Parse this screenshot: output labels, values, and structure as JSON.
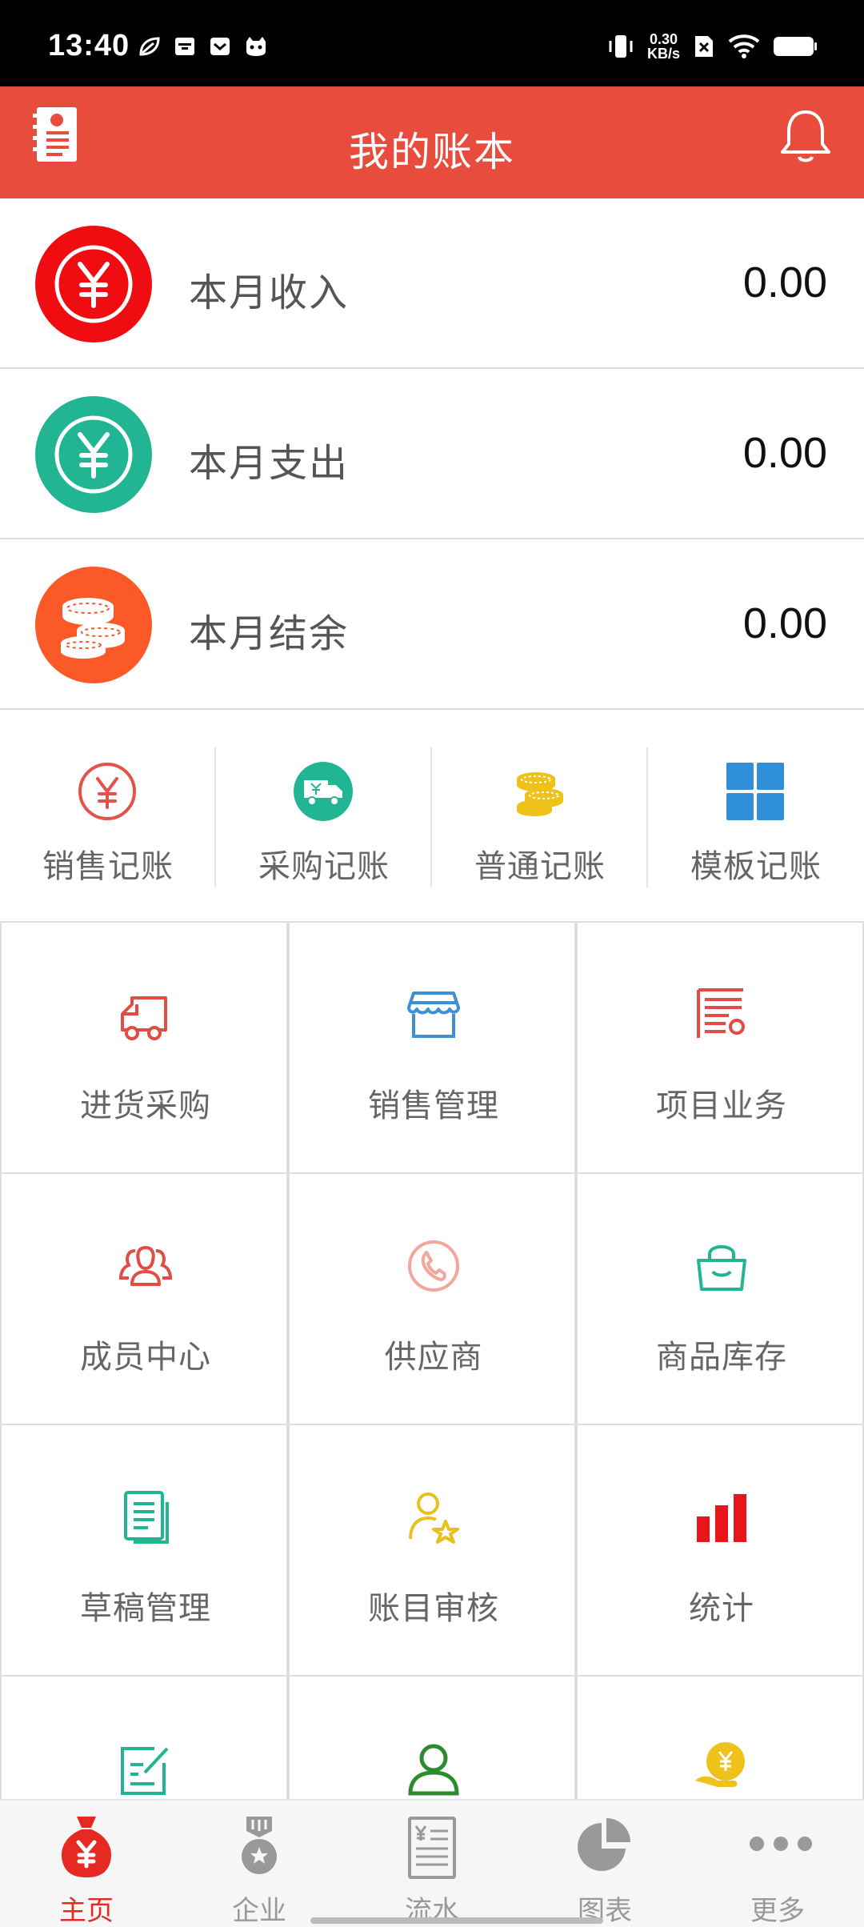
{
  "status_bar": {
    "time": "13:40",
    "net_speed_value": "0.30",
    "net_speed_unit": "KB/s",
    "icons": [
      "leaf-icon",
      "archive-icon",
      "message-icon",
      "cat-icon",
      "vibrate-icon",
      "sim-x-icon",
      "wifi-icon",
      "battery-icon"
    ]
  },
  "header": {
    "title": "我的账本",
    "left_icon": "ledger-book-icon",
    "right_icon": "bell-icon",
    "background": "#e84c3d"
  },
  "summary": [
    {
      "label": "本月收入",
      "value": "0.00",
      "icon": "yuan-circle-icon",
      "color": "#f00d12"
    },
    {
      "label": "本月支出",
      "value": "0.00",
      "icon": "yuan-circle-icon",
      "color": "#21b594"
    },
    {
      "label": "本月结余",
      "value": "0.00",
      "icon": "coins-icon",
      "color": "#fb5a28"
    }
  ],
  "quick_actions": [
    {
      "label": "销售记账",
      "icon": "yuan-outline-icon",
      "color": "#e4524a"
    },
    {
      "label": "采购记账",
      "icon": "truck-icon",
      "color": "#21b594"
    },
    {
      "label": "普通记账",
      "icon": "coins-stack-icon",
      "color": "#efc21a"
    },
    {
      "label": "模板记账",
      "icon": "grid-squares-icon",
      "color": "#2f8fd8"
    }
  ],
  "grid": [
    {
      "label": "进货采购",
      "icon": "delivery-truck-icon",
      "color": "#e14c44"
    },
    {
      "label": "销售管理",
      "icon": "storefront-icon",
      "color": "#3d8fd6"
    },
    {
      "label": "项目业务",
      "icon": "document-list-icon",
      "color": "#e14c44"
    },
    {
      "label": "成员中心",
      "icon": "members-icon",
      "color": "#e14c44"
    },
    {
      "label": "供应商",
      "icon": "phone-icon",
      "color": "#f2a79c"
    },
    {
      "label": "商品库存",
      "icon": "shopping-bag-icon",
      "color": "#21b594"
    },
    {
      "label": "草稿管理",
      "icon": "draft-docs-icon",
      "color": "#21b594"
    },
    {
      "label": "账目审核",
      "icon": "user-star-icon",
      "color": "#e8c21c"
    },
    {
      "label": "统计",
      "icon": "bar-chart-icon",
      "color": "#e9151b"
    },
    {
      "label": "",
      "icon": "edit-note-icon",
      "color": "#21b594"
    },
    {
      "label": "",
      "icon": "person-icon",
      "color": "#2c8b2c"
    },
    {
      "label": "",
      "icon": "hand-yuan-icon",
      "color": "#efc21a"
    }
  ],
  "bottom_nav": [
    {
      "label": "主页",
      "icon": "money-bag-icon",
      "active": true
    },
    {
      "label": "企业",
      "icon": "medal-icon",
      "active": false
    },
    {
      "label": "流水",
      "icon": "receipt-icon",
      "active": false
    },
    {
      "label": "图表",
      "icon": "pie-chart-icon",
      "active": false
    },
    {
      "label": "更多",
      "icon": "more-dots-icon",
      "active": false
    }
  ],
  "colors": {
    "active_tab": "#e42a23",
    "inactive_tab": "#999999"
  }
}
